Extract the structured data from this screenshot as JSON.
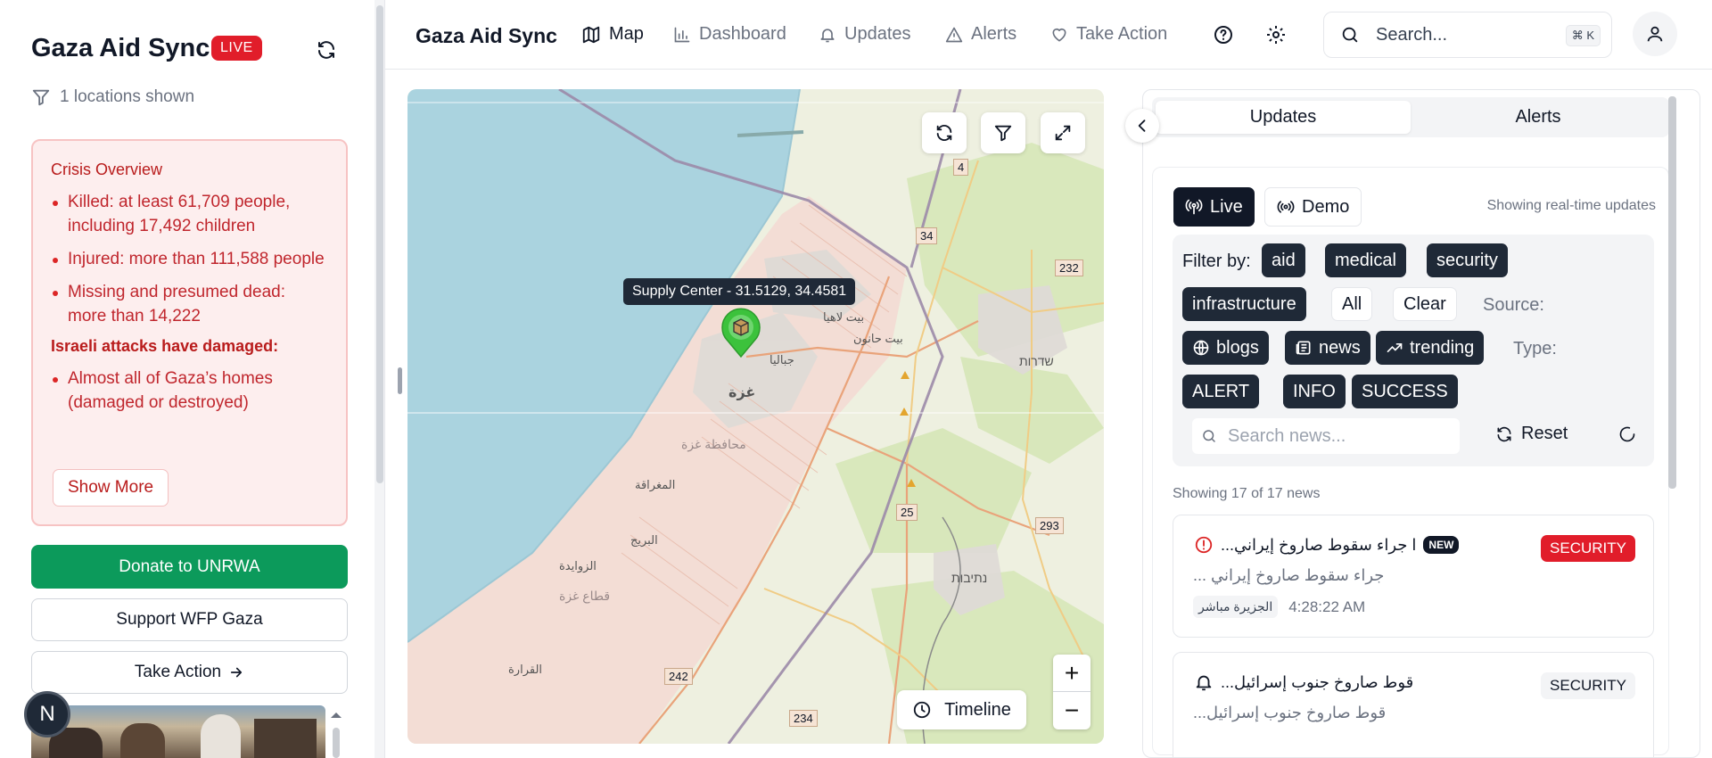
{
  "sidebar": {
    "title": "Gaza Aid Sync",
    "live_badge": "LIVE",
    "locations_shown": "1 locations shown",
    "crisis": {
      "heading": "Crisis Overview",
      "items": [
        "Killed: at least 61,709 people, including 17,492 children",
        "Injured: more than 111,588 people",
        "Missing and presumed dead: more than 14,222"
      ],
      "subheading": "Israeli attacks have damaged:",
      "damage_items": [
        "Almost all of Gaza’s homes (damaged or destroyed)"
      ],
      "show_more": "Show More"
    },
    "donate_unrwa": "Donate to UNRWA",
    "support_wfp": "Support WFP Gaza",
    "take_action": "Take Action",
    "avatar_initial": "N"
  },
  "topnav": {
    "brand": "Gaza Aid Sync",
    "items": [
      {
        "label": "Map",
        "icon": "map-icon"
      },
      {
        "label": "Dashboard",
        "icon": "bar-chart-icon"
      },
      {
        "label": "Updates",
        "icon": "bell-icon"
      },
      {
        "label": "Alerts",
        "icon": "warning-icon"
      },
      {
        "label": "Take Action",
        "icon": "heart-icon"
      }
    ],
    "search_placeholder": "Search...",
    "search_shortcut": "⌘ K"
  },
  "map": {
    "tooltip": "Supply Center - 31.5129, 34.4581",
    "timeline": "Timeline",
    "zoom_in": "+",
    "zoom_out": "−",
    "labels": {
      "beit_lahia": "بيت لاهيا",
      "beit_hanoun": "بيت حانون",
      "jabalia": "جباليا",
      "gaza": "غزة",
      "sderot": "שדרות",
      "gaza_gov": "محافظة غزة",
      "mughraqa": "المغراقة",
      "bureij": "البريج",
      "zawaida": "الزوايدة",
      "gaza_strip": "قطاع غزة",
      "qarara": "القرارة",
      "netivot": "נתיבות",
      "road_4": "4",
      "road_34": "34",
      "road_232": "232",
      "road_25": "25",
      "road_293": "293",
      "road_242": "242",
      "road_234": "234"
    }
  },
  "rpanel": {
    "tabs": [
      "Updates",
      "Alerts"
    ],
    "mode_live": "Live",
    "mode_demo": "Demo",
    "realtime_text": "Showing real-time updates",
    "filter_by": "Filter by:",
    "categories": [
      "aid",
      "medical",
      "security",
      "infrastructure"
    ],
    "all": "All",
    "clear": "Clear",
    "source_label": "Source:",
    "sources": [
      "blogs",
      "news",
      "trending"
    ],
    "type_label": "Type:",
    "types": [
      "ALERT",
      "INFO",
      "SUCCESS"
    ],
    "search_placeholder": "Search news...",
    "reset": "Reset",
    "count": "Showing 17 of 17 news",
    "news": [
      {
        "title": "...ا جراء سقوط صاروخ إيراني",
        "new_badge": "NEW",
        "category": "SECURITY",
        "subtitle": "... جراء سقوط صاروخ إيراني",
        "source": "الجزيرة مباشر",
        "time": "4:28:22 AM"
      },
      {
        "title": "...قوط صاروخ جنوب إسرائيل",
        "category": "SECURITY",
        "subtitle": "...قوط صاروخ جنوب إسرائيل"
      }
    ]
  },
  "colors": {
    "live_red": "#e11d2a",
    "donate_green": "#0c9a5b",
    "crisis_bg": "#fdeeee",
    "crisis_text": "#c0262d",
    "marker_green": "#3cc23c"
  }
}
